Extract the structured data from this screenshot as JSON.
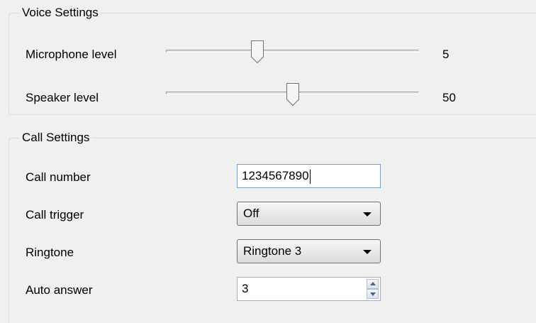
{
  "voice_settings": {
    "title": "Voice Settings",
    "microphone": {
      "label": "Microphone level",
      "value": "5",
      "slider_fraction": 0.36
    },
    "speaker": {
      "label": "Speaker level",
      "value": "50",
      "slider_fraction": 0.5
    }
  },
  "call_settings": {
    "title": "Call Settings",
    "call_number": {
      "label": "Call number",
      "value": "1234567890"
    },
    "call_trigger": {
      "label": "Call trigger",
      "selected": "Off"
    },
    "ringtone": {
      "label": "Ringtone",
      "selected": "Ringtone 3"
    },
    "auto_answer": {
      "label": "Auto answer",
      "value": "3"
    }
  },
  "icons": {
    "slider_thumb": "slider-thumb-icon",
    "dropdown_arrow": "chevron-down-icon",
    "spin_up": "spin-up-icon",
    "spin_down": "spin-down-icon"
  },
  "colors": {
    "background": "#f0f0f0",
    "textbox_focus_border": "#7a9cc0",
    "groupbox_border": "#d5dfe5"
  }
}
